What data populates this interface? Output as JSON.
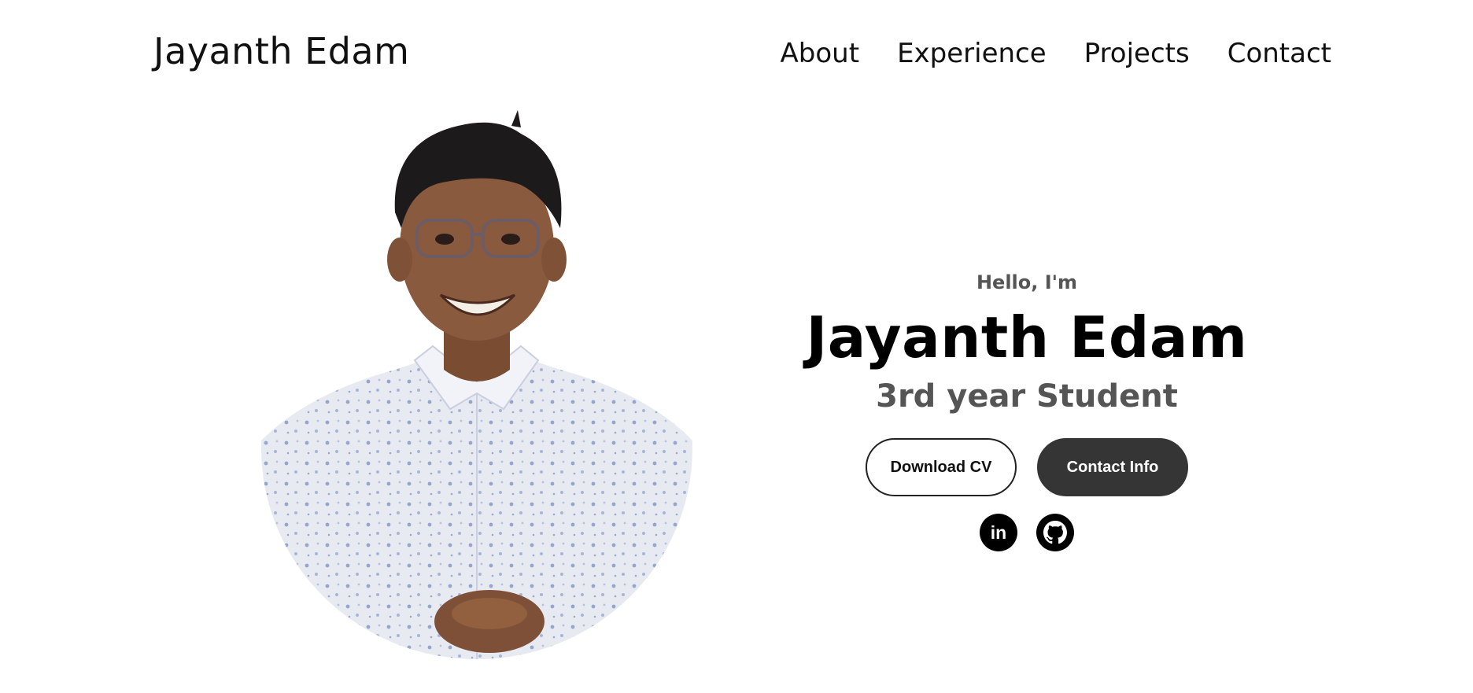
{
  "nav": {
    "logo": "Jayanth Edam",
    "links": [
      "About",
      "Experience",
      "Projects",
      "Contact"
    ]
  },
  "hero": {
    "greeting": "Hello, I'm",
    "name": "Jayanth Edam",
    "role": "3rd year Student",
    "buttons": {
      "download_cv": "Download CV",
      "contact_info": "Contact Info"
    },
    "socials": {
      "linkedin_icon": "linkedin-icon",
      "github_icon": "github-icon",
      "linkedin_glyph": "in"
    },
    "photo": {
      "icon": "profile-photo",
      "colors": {
        "skin": "#8a5a3e",
        "hair": "#1c1a1b",
        "shirt": "#e6e8f0",
        "shirt_pattern": "#8fa3c8"
      }
    }
  },
  "colors": {
    "text": "#111111",
    "muted": "#555555",
    "button_dark": "#353535",
    "background": "#ffffff"
  }
}
